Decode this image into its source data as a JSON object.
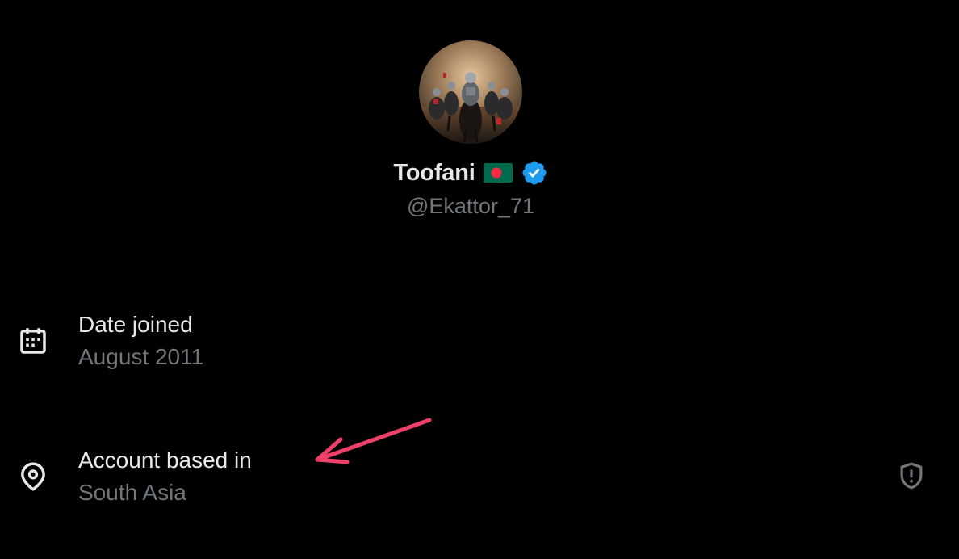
{
  "profile": {
    "display_name": "Toofani",
    "handle": "@Ekattor_71",
    "verified": true,
    "verified_color": "#1d9bf0"
  },
  "about": {
    "date_joined": {
      "label": "Date joined",
      "value": "August 2011",
      "icon": "calendar-icon"
    },
    "account_based_in": {
      "label": "Account based in",
      "value": "South Asia",
      "icon": "location-pin-icon"
    }
  },
  "colors": {
    "background": "#000000",
    "primary_text": "#e7e9ea",
    "secondary_text": "#71767b",
    "annotation_arrow": "#f0406a"
  }
}
